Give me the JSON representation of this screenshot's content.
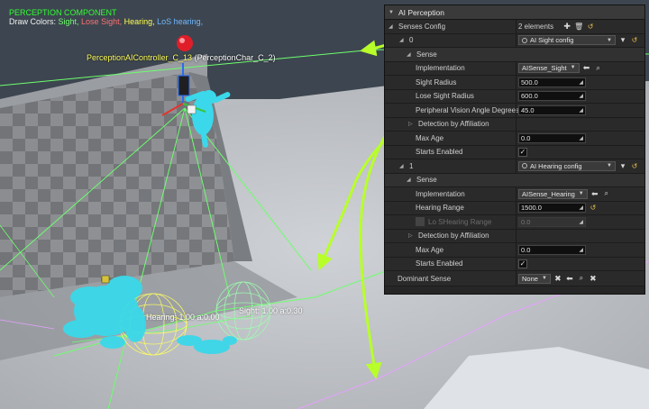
{
  "viewport": {
    "debug_title": "PERCEPTION COMPONENT",
    "draw_colors_prefix": "Draw Colors: ",
    "color_sight": "Sight,",
    "color_lose_sight": "Lose Sight,",
    "color_hearing": "Hearing,",
    "color_los_hearing": "LoS hearing,",
    "controller_name": "PerceptionAIController_C_13",
    "controller_char": " (PerceptionChar_C_2)",
    "hearing_label": "Hearing: 1.00 a:0.00",
    "sight_label": "Sight: 1.00 a:0.30",
    "colors": {
      "sight": "#6dff6d",
      "lose_sight": "#ff7070",
      "hearing": "#ffff50",
      "los_hearing": "#70b8ff",
      "arrow": "#b8ff2a",
      "character": "#3ad8ea"
    }
  },
  "panel": {
    "title": "AI Perception",
    "senses_config_label": "Senses Config",
    "senses_count": "2 elements",
    "index_0": "0",
    "index_1": "1",
    "sight_config": "AI Sight config",
    "hearing_config": "AI Hearing config",
    "sense_label": "Sense",
    "implementation_label": "Implementation",
    "sight_impl": "AISense_Sight",
    "hearing_impl": "AISense_Hearing",
    "sight_radius_label": "Sight Radius",
    "sight_radius": "500.0",
    "lose_sight_radius_label": "Lose Sight Radius",
    "lose_sight_radius": "600.0",
    "peripheral_label": "Peripheral Vision Angle Degrees",
    "peripheral_value": "45.0",
    "detection_label": "Detection by Affiliation",
    "max_age_label": "Max Age",
    "sight_max_age": "0.0",
    "starts_enabled_label": "Starts Enabled",
    "hearing_range_label": "Hearing Range",
    "hearing_range": "1500.0",
    "los_hearing_label": "Lo SHearing Range",
    "los_hearing_range": "0.0",
    "hearing_max_age": "0.0",
    "dominant_sense_label": "Dominant Sense",
    "dominant_sense_value": "None"
  }
}
